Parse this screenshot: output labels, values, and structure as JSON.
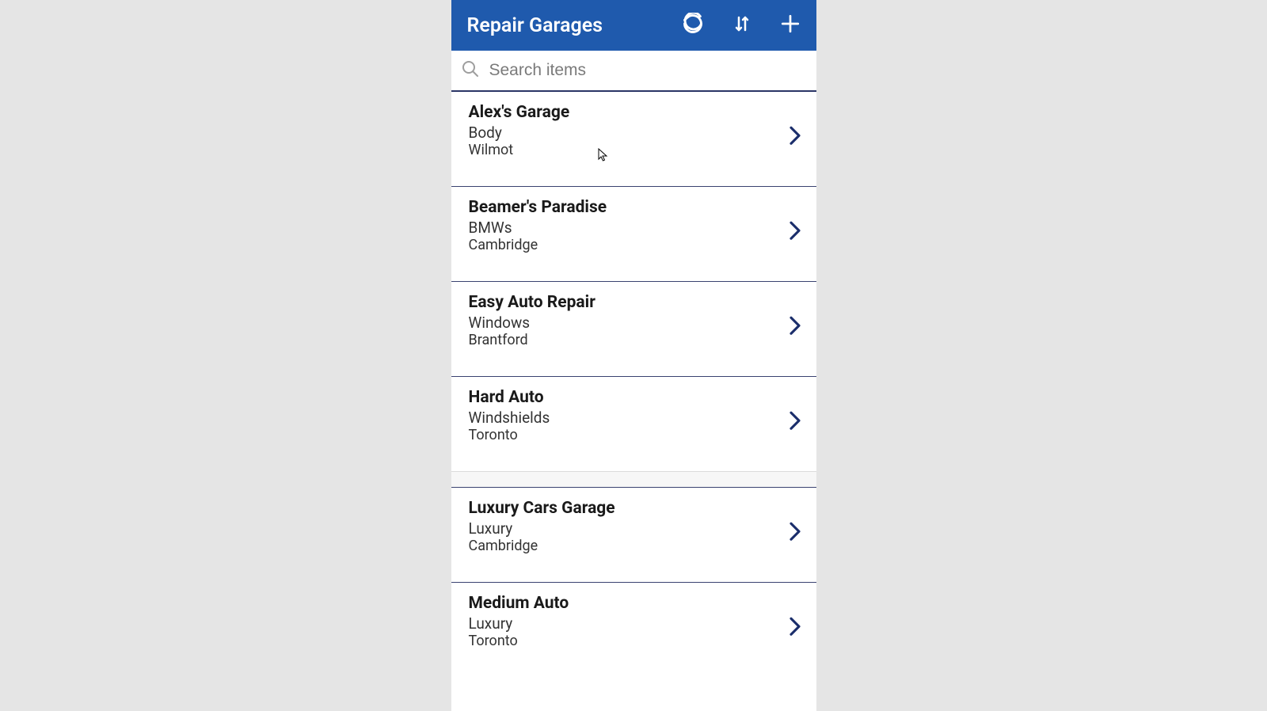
{
  "header": {
    "title": "Repair Garages"
  },
  "search": {
    "placeholder": "Search items"
  },
  "items": [
    {
      "title": "Alex's Garage",
      "subtitle": "Body",
      "location": "Wilmot"
    },
    {
      "title": "Beamer's Paradise",
      "subtitle": "BMWs",
      "location": "Cambridge"
    },
    {
      "title": "Easy Auto Repair",
      "subtitle": "Windows",
      "location": "Brantford"
    },
    {
      "title": "Hard Auto",
      "subtitle": "Windshields",
      "location": "Toronto"
    },
    {
      "title": "Luxury Cars Garage",
      "subtitle": "Luxury",
      "location": "Cambridge"
    },
    {
      "title": "Medium Auto",
      "subtitle": "Luxury",
      "location": "Toronto"
    }
  ]
}
